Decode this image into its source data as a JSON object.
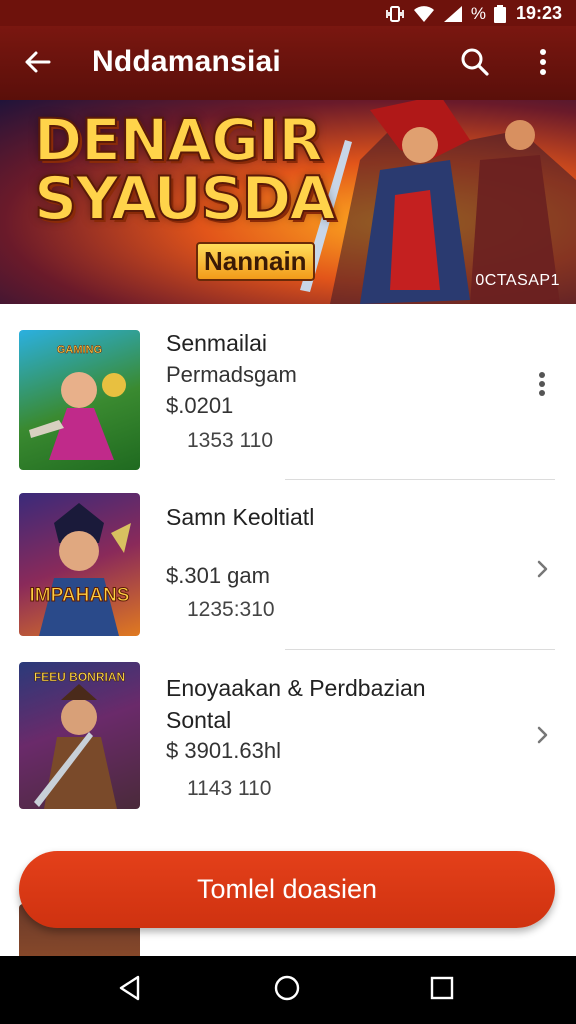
{
  "status_bar": {
    "time": "19:23",
    "battery_text": "%"
  },
  "app_bar": {
    "title": "Nddamansiai"
  },
  "banner": {
    "title_line1": "DENAGIR",
    "title_line2": "SYAUSDA",
    "subtitle": "Nannain",
    "code": "0CTASAP1"
  },
  "items": [
    {
      "thumb_caption": "GAMING",
      "name": "Senmailai",
      "subtitle": "Permadsgam",
      "price": "$.0201",
      "count": "1353 110",
      "action_icon": "kebab-icon"
    },
    {
      "thumb_caption": "IMPAHANS",
      "name": "Samn Keoltiatl",
      "subtitle": "",
      "price": "$.301 gam",
      "count": "1235:310",
      "action_icon": "chevron-right-icon"
    },
    {
      "thumb_caption": "FEEU BONRIAN",
      "name": "Enoyaakan & Perdbazian",
      "subtitle": "Sontal",
      "price": "$ 3901.63hl",
      "count": "1143 110",
      "action_icon": "chevron-right-icon"
    }
  ],
  "fab": {
    "label": "Tomlel doasien"
  },
  "colors": {
    "app_bar": "#6e130c",
    "fab": "#d9381a",
    "nav_bar": "#000000"
  }
}
